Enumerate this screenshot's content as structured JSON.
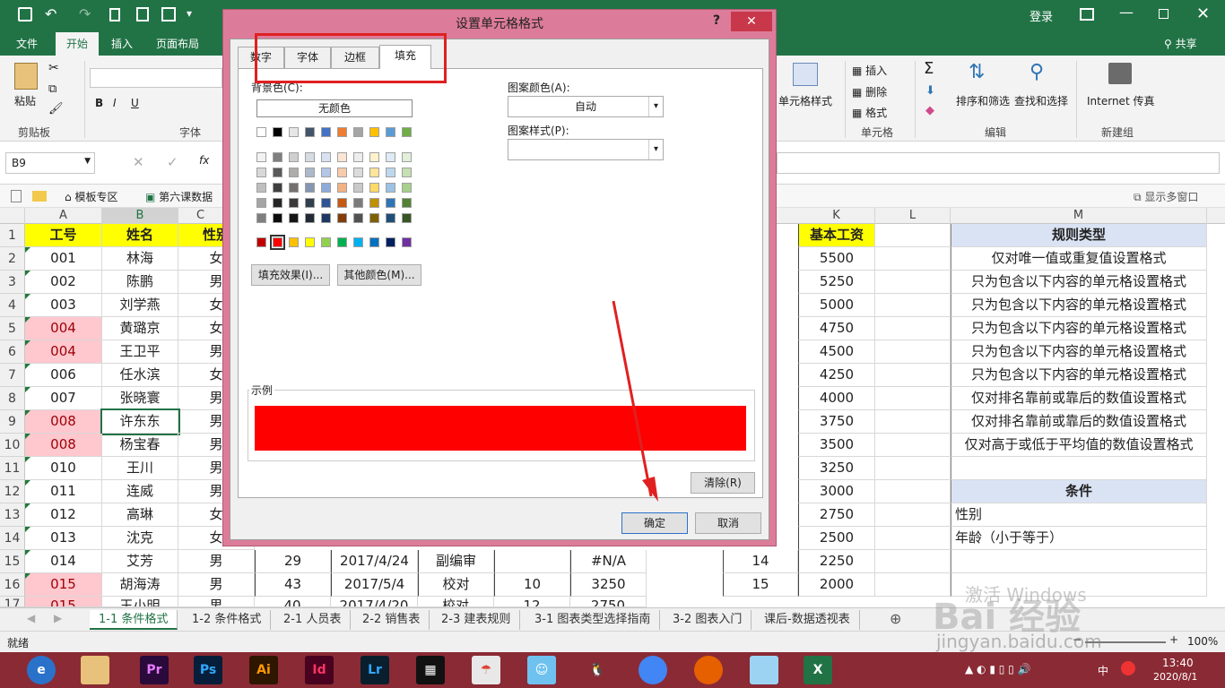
{
  "titlebar": {
    "login": "登录",
    "icons": [
      "save-icon",
      "undo-icon",
      "redo-icon",
      "new-doc-icon",
      "print-preview-icon",
      "form-icon",
      "ribbon-options-icon",
      "minimize-icon",
      "restore-icon",
      "close-icon"
    ]
  },
  "ribbon_tabs": [
    "文件",
    "开始",
    "插入",
    "页面布局"
  ],
  "share": "共享",
  "ribbon": {
    "paste": "粘贴",
    "clipboard": "剪贴板",
    "font_group": "字体",
    "insert": "插入",
    "delete": "删除",
    "format": "格式",
    "cells_group": "单元格",
    "cell_style": "单元格样式",
    "sort_filter": "排序和筛选",
    "find_select": "查找和选择",
    "edit_group": "编辑",
    "internet": "Internet 传真",
    "new_group": "新建组",
    "bold": "B",
    "italic": "I",
    "underline": "U"
  },
  "formula_bar": {
    "name_box": "B9",
    "fx": "fx"
  },
  "bookmarks": {
    "template": "模板专区",
    "file": "第六课数据",
    "multi_window": "显示多窗口"
  },
  "columns_left": [
    "A",
    "B",
    "C"
  ],
  "columns_right": [
    "K",
    "L",
    "M"
  ],
  "rows": [
    {
      "n": "1",
      "id": "工号",
      "name": "姓名",
      "sex": "性别",
      "k": "基本工资",
      "m": "规则类型"
    },
    {
      "n": "2",
      "id": "001",
      "name": "林海",
      "sex": "女",
      "k": "5500",
      "m": "仅对唯一值或重复值设置格式"
    },
    {
      "n": "3",
      "id": "002",
      "name": "陈鹏",
      "sex": "男",
      "k": "5250",
      "m": "只为包含以下内容的单元格设置格式"
    },
    {
      "n": "4",
      "id": "003",
      "name": "刘学燕",
      "sex": "女",
      "k": "5000",
      "m": "只为包含以下内容的单元格设置格式"
    },
    {
      "n": "5",
      "id": "004",
      "name": "黄璐京",
      "sex": "女",
      "k": "4750",
      "m": "只为包含以下内容的单元格设置格式"
    },
    {
      "n": "6",
      "id": "004",
      "name": "王卫平",
      "sex": "男",
      "k": "4500",
      "m": "只为包含以下内容的单元格设置格式"
    },
    {
      "n": "7",
      "id": "006",
      "name": "任水滨",
      "sex": "女",
      "k": "4250",
      "m": "只为包含以下内容的单元格设置格式"
    },
    {
      "n": "8",
      "id": "007",
      "name": "张晓寰",
      "sex": "男",
      "k": "4000",
      "m": "仅对排名靠前或靠后的数值设置格式"
    },
    {
      "n": "9",
      "id": "008",
      "name": "许东东",
      "sex": "男",
      "k": "3750",
      "m": "仅对排名靠前或靠后的数值设置格式"
    },
    {
      "n": "10",
      "id": "008",
      "name": "杨宝春",
      "sex": "男",
      "k": "3500",
      "m": "仅对高于或低于平均值的数值设置格式"
    },
    {
      "n": "11",
      "id": "010",
      "name": "王川",
      "sex": "男",
      "k": "3250",
      "m": ""
    },
    {
      "n": "12",
      "id": "011",
      "name": "连威",
      "sex": "男",
      "k": "3000",
      "m": "条件"
    },
    {
      "n": "13",
      "id": "012",
      "name": "高琳",
      "sex": "女",
      "k": "2750",
      "m": "性别"
    },
    {
      "n": "14",
      "id": "013",
      "name": "沈克",
      "sex": "女",
      "k": "2500",
      "m": "年龄（小于等于）"
    },
    {
      "n": "15",
      "id": "014",
      "name": "艾芳",
      "sex": "男",
      "k": "2250",
      "m": ""
    },
    {
      "n": "16",
      "id": "015",
      "name": "胡海涛",
      "sex": "男",
      "k": "2000",
      "m": ""
    }
  ],
  "row15_extra": {
    "d": "29",
    "e": "2017/4/24",
    "f": "副编审",
    "g": "",
    "h": "#N/A",
    "j": "14"
  },
  "row16_extra": {
    "d": "43",
    "e": "2017/5/4",
    "f": "校对",
    "g": "10",
    "h": "3250",
    "j": "15"
  },
  "row17_partial": {
    "n": "17",
    "id": "015",
    "name": "王小明",
    "sex": "男",
    "d": "40",
    "e": "2017/4/20",
    "f": "校对",
    "g": "12",
    "h": "2750"
  },
  "sheet_tabs": [
    "1-1 条件格式",
    "1-2 条件格式",
    "2-1 人员表",
    "2-2 销售表",
    "2-3 建表规则",
    "3-1 图表类型选择指南",
    "3-2 图表入门",
    "课后-数据透视表"
  ],
  "status": {
    "ready": "就绪",
    "zoom": "100%"
  },
  "taskbar": {
    "time": "13:40",
    "date": "2020/8/1",
    "lang": "中"
  },
  "watermark": {
    "activate": "激活 Windows",
    "baidu": "Bai 经验",
    "url": "jingyan.baidu.com"
  },
  "dialog": {
    "title": "设置单元格格式",
    "help": "?",
    "tabs": [
      "数字",
      "字体",
      "边框",
      "填充"
    ],
    "bg_color_label": "背景色(C):",
    "no_color": "无颜色",
    "fill_effects": "填充效果(I)...",
    "more_colors": "其他颜色(M)...",
    "pattern_color_label": "图案颜色(A):",
    "pattern_color_value": "自动",
    "pattern_style_label": "图案样式(P):",
    "pattern_style_value": "",
    "sample_label": "示例",
    "sample_color": "#ff0000",
    "clear": "清除(R)",
    "ok": "确定",
    "cancel": "取消",
    "theme_row": [
      "#ffffff",
      "#000000",
      "#e7e6e6",
      "#44546a",
      "#4472c4",
      "#ed7d31",
      "#a5a5a5",
      "#ffc000",
      "#5b9bd5",
      "#70ad47"
    ],
    "shades": [
      [
        "#f2f2f2",
        "#7f7f7f",
        "#d0cece",
        "#d6dce4",
        "#d9e2f3",
        "#fbe5d5",
        "#ededed",
        "#fff2cc",
        "#deebf6",
        "#e2efd9"
      ],
      [
        "#d8d8d8",
        "#595959",
        "#aeabab",
        "#adb9ca",
        "#b4c6e7",
        "#f7cbac",
        "#dbdbdb",
        "#fee599",
        "#bdd7ee",
        "#c5e0b3"
      ],
      [
        "#bfbfbf",
        "#3f3f3f",
        "#757070",
        "#8496b0",
        "#8eaadb",
        "#f4b183",
        "#c9c9c9",
        "#ffd965",
        "#9cc3e5",
        "#a8d08d"
      ],
      [
        "#a5a5a5",
        "#262626",
        "#3a3838",
        "#323f4f",
        "#2f5496",
        "#c55a11",
        "#7b7b7b",
        "#bf9000",
        "#2e75b5",
        "#538135"
      ],
      [
        "#7f7f7f",
        "#0c0c0c",
        "#171616",
        "#222a35",
        "#1e3864",
        "#833c0b",
        "#525252",
        "#7f6000",
        "#1e4e79",
        "#375623"
      ]
    ],
    "standard": [
      "#c00000",
      "#ff0000",
      "#ffc000",
      "#ffff00",
      "#92d050",
      "#00b050",
      "#00b0f0",
      "#0070c0",
      "#002060",
      "#7030a0"
    ]
  },
  "accent_colors": {
    "excel_green": "#217346",
    "annotation_red": "#e02020"
  }
}
